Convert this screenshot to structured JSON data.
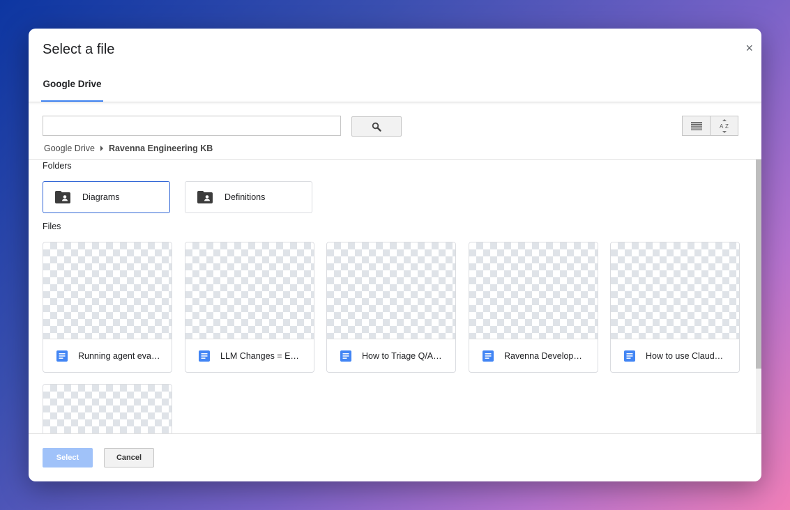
{
  "dialog": {
    "title": "Select a file",
    "close_glyph": "×",
    "tabs": [
      {
        "label": "Google Drive",
        "active": true
      }
    ]
  },
  "search": {
    "value": "",
    "placeholder": ""
  },
  "breadcrumb": {
    "root": "Google Drive",
    "current": "Ravenna Engineering KB"
  },
  "folders_label": "Folders",
  "folders": [
    {
      "name": "Diagrams",
      "icon": "shared-folder-icon",
      "selected": true
    },
    {
      "name": "Definitions",
      "icon": "shared-folder-icon",
      "selected": false
    }
  ],
  "files_label": "Files",
  "files": [
    {
      "name": "Running agent eva…",
      "icon": "google-docs-icon"
    },
    {
      "name": "LLM Changes = Ev…",
      "icon": "google-docs-icon"
    },
    {
      "name": "How to Triage Q/A…",
      "icon": "google-docs-icon"
    },
    {
      "name": "Ravenna Develope…",
      "icon": "google-docs-icon"
    },
    {
      "name": "How to use Claud…",
      "icon": "google-docs-icon"
    },
    {
      "name": "",
      "icon": "google-docs-icon"
    }
  ],
  "footer": {
    "select_label": "Select",
    "cancel_label": "Cancel"
  },
  "colors": {
    "accent": "#4285f4",
    "select_disabled": "#a0c2f9",
    "doc_icon": "#4285f4",
    "selected_border": "#3367d6"
  }
}
